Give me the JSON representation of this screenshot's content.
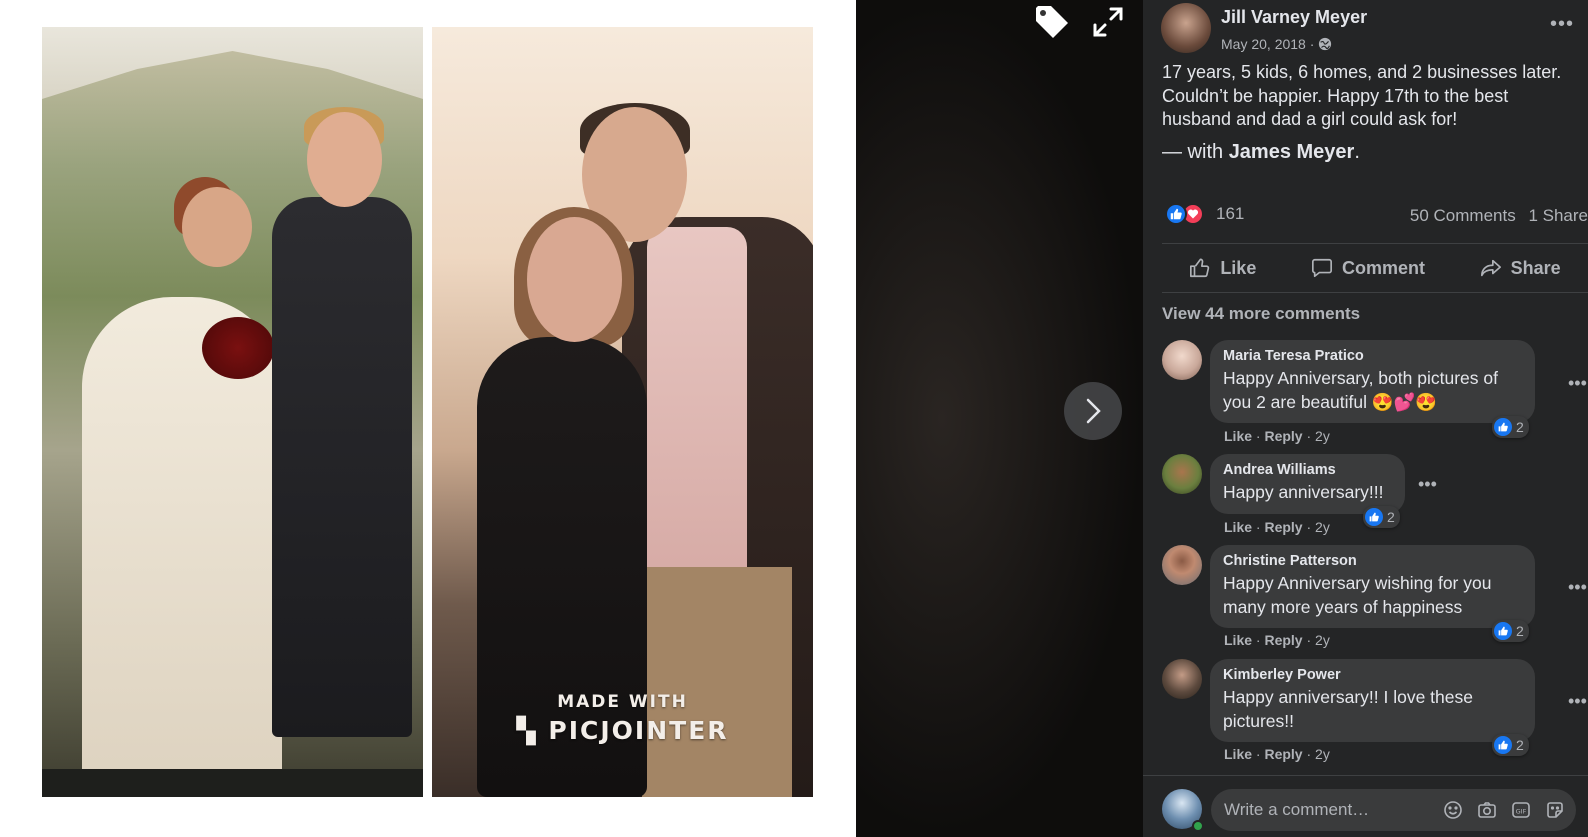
{
  "photo": {
    "watermark_line1": "MADE WITH",
    "watermark_line2": "▚ PICJOINTER"
  },
  "viewer_controls": {
    "tag_icon": "tag-icon",
    "expand_icon": "expand-icon",
    "next_icon": "chevron-right-icon"
  },
  "post": {
    "author": "Jill Varney Meyer",
    "date": "May 20, 2018 · ",
    "privacy_icon": "globe-icon",
    "text": "17 years, 5 kids, 6 homes, and 2 businesses later. Couldn’t be happier. Happy 17th to the best husband and dad a girl could ask for!",
    "with_prefix": "— with ",
    "with_name": "James Meyer",
    "with_suffix": ".",
    "reaction_count": "161",
    "comments_count": "50 Comments",
    "shares_count": "1 Share"
  },
  "actions": {
    "like": "Like",
    "comment": "Comment",
    "share": "Share"
  },
  "comments_section": {
    "view_more": "View 44 more comments",
    "items": [
      {
        "name": "Maria Teresa Pratico",
        "text": "Happy Anniversary, both pictures of you 2 are beautiful 😍💕😍",
        "reactions": "2",
        "like": "Like",
        "reply": "Reply",
        "age": "2y"
      },
      {
        "name": "Andrea Williams",
        "text": "Happy anniversary!!!",
        "reactions": "2",
        "like": "Like",
        "reply": "Reply",
        "age": "2y"
      },
      {
        "name": "Christine Patterson",
        "text": "Happy Anniversary wishing for you many more years of happiness",
        "reactions": "2",
        "like": "Like",
        "reply": "Reply",
        "age": "2y"
      },
      {
        "name": "Kimberley Power",
        "text": "Happy anniversary!! I love these pictures!!",
        "reactions": "2",
        "like": "Like",
        "reply": "Reply",
        "age": "2y"
      }
    ]
  },
  "composer": {
    "placeholder": "Write a comment…"
  },
  "colors": {
    "panel_bg": "#242526",
    "bubble_bg": "#3a3b3c",
    "like_blue": "#1877f2",
    "love_red": "#f33e58"
  }
}
